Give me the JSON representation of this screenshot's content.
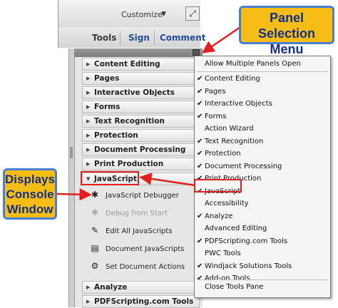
{
  "toolbar": {
    "customize_label": "Customize",
    "dropdown_glyph": "▼",
    "expand_glyph": "⤢"
  },
  "tabs": [
    "Tools",
    "Sign",
    "Comment"
  ],
  "panels_top": [
    "Content Editing",
    "Pages",
    "Interactive Objects",
    "Forms",
    "Text Recognition",
    "Protection",
    "Document Processing",
    "Print Production"
  ],
  "javascript_panel": "JavaScript",
  "javascript_tools": [
    {
      "label": "JavaScript Debugger",
      "icon": "bug-icon",
      "enabled": true
    },
    {
      "label": "Debug from Start",
      "icon": "bug-icon",
      "enabled": false
    },
    {
      "label": "Edit All JavaScripts",
      "icon": "edit-icon",
      "enabled": true
    },
    {
      "label": "Document JavaScripts",
      "icon": "document-icon",
      "enabled": true
    },
    {
      "label": "Set Document Actions",
      "icon": "actions-icon",
      "enabled": true
    }
  ],
  "panels_bottom": [
    "Analyze",
    "PDFScripting.com Tools"
  ],
  "menu": {
    "header": "Allow Multiple Panels Open",
    "items": [
      {
        "label": "Content Editing",
        "checked": true
      },
      {
        "label": "Pages",
        "checked": true
      },
      {
        "label": "Interactive Objects",
        "checked": true
      },
      {
        "label": "Forms",
        "checked": true
      },
      {
        "label": "Action Wizard",
        "checked": false
      },
      {
        "label": "Text Recognition",
        "checked": true
      },
      {
        "label": "Protection",
        "checked": true
      },
      {
        "label": "Document Processing",
        "checked": true
      },
      {
        "label": "Print Production",
        "checked": true
      },
      {
        "label": "JavaScript",
        "checked": true
      },
      {
        "label": "Accessibility",
        "checked": false
      },
      {
        "label": "Analyze",
        "checked": true
      },
      {
        "label": "Advanced Editing",
        "checked": false
      },
      {
        "label": "PDFScripting.com Tools",
        "checked": true
      },
      {
        "label": "PWC Tools",
        "checked": false
      },
      {
        "label": "Windjack Solutions Tools",
        "checked": true
      },
      {
        "label": "Add-on Tools",
        "checked": true
      }
    ],
    "footer": "Close Tools Pane"
  },
  "callouts": {
    "panel_selection": [
      "Panel Selection",
      "Menu"
    ],
    "console": [
      "Displays",
      "Console",
      "Window"
    ]
  },
  "colors": {
    "callout_fill": "#f6bd16",
    "callout_border": "#4a7ed0",
    "highlight": "#e02020"
  }
}
